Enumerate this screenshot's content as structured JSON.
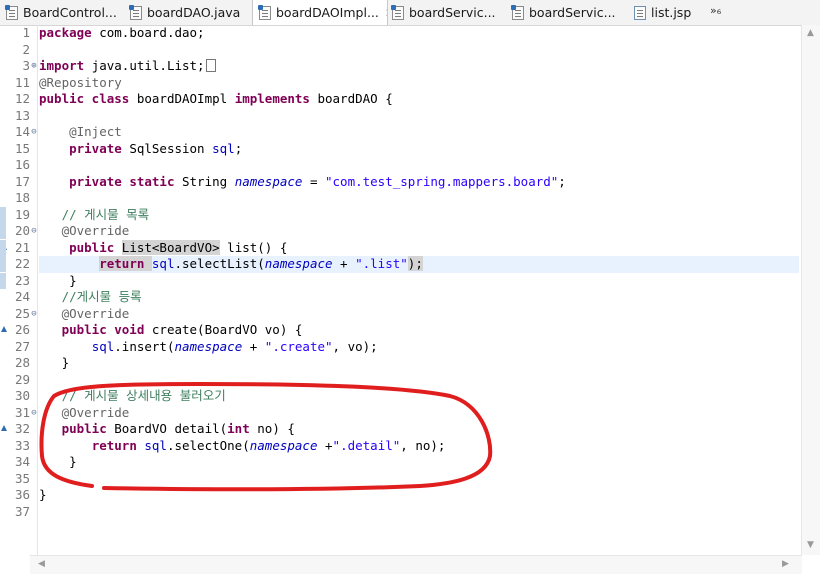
{
  "tabs": [
    {
      "label": "BoardControl...",
      "icon": "java-file-icon",
      "active": false,
      "closable": false
    },
    {
      "label": "boardDAO.java",
      "icon": "java-file-icon",
      "active": false,
      "closable": false
    },
    {
      "label": "boardDAOImpl...",
      "icon": "java-file-icon",
      "active": true,
      "closable": true
    },
    {
      "label": "boardServic...",
      "icon": "java-file-icon",
      "active": false,
      "closable": false
    },
    {
      "label": "boardServic...",
      "icon": "java-file-icon",
      "active": false,
      "closable": false
    },
    {
      "label": "list.jsp",
      "icon": "jsp-file-icon",
      "active": false,
      "closable": false
    }
  ],
  "tab_overflow": "»₆",
  "colors": {
    "annotation_circle": "#e01e1e",
    "keyword": "#7f0055",
    "string": "#2a00ff",
    "comment": "#3f7f5f",
    "field": "#0000c0"
  },
  "editor": {
    "line_numbers": [
      "1",
      "2",
      "3",
      "11",
      "12",
      "13",
      "14",
      "15",
      "16",
      "17",
      "18",
      "19",
      "20",
      "21",
      "22",
      "23",
      "24",
      "25",
      "26",
      "27",
      "28",
      "29",
      "30",
      "31",
      "32",
      "33",
      "34",
      "35",
      "36",
      "37"
    ],
    "folds": [
      "",
      "",
      "⊕",
      "",
      "",
      "",
      "⊖",
      "",
      "",
      "",
      "",
      "",
      "⊖",
      "",
      "",
      "",
      "",
      "⊖",
      "",
      "",
      "",
      "",
      "",
      "⊖",
      "",
      "",
      "",
      "",
      "",
      ""
    ],
    "override_markers": [
      "21",
      "26",
      "32"
    ],
    "highlight_line": "22",
    "lines": [
      [
        {
          "t": "package ",
          "c": "kw"
        },
        {
          "t": "com.board.dao;",
          "c": "tx"
        }
      ],
      [],
      [
        {
          "t": "import ",
          "c": "kw"
        },
        {
          "t": "java.util.List;",
          "c": "tx"
        }
      ],
      [
        {
          "t": "@Repository",
          "c": "an"
        }
      ],
      [
        {
          "t": "public class ",
          "c": "kw"
        },
        {
          "t": "boardDAOImpl ",
          "c": "tx"
        },
        {
          "t": "implements ",
          "c": "kw"
        },
        {
          "t": "boardDAO {",
          "c": "tx"
        }
      ],
      [],
      [
        {
          "t": "    @Inject",
          "c": "an"
        }
      ],
      [
        {
          "t": "    ",
          "c": "tx"
        },
        {
          "t": "private ",
          "c": "kw"
        },
        {
          "t": "SqlSession ",
          "c": "tx"
        },
        {
          "t": "sql",
          "c": "fi"
        },
        {
          "t": ";",
          "c": "tx"
        }
      ],
      [],
      [
        {
          "t": "    ",
          "c": "tx"
        },
        {
          "t": "private static ",
          "c": "kw"
        },
        {
          "t": "String ",
          "c": "tx"
        },
        {
          "t": "namespace",
          "c": "sfi"
        },
        {
          "t": " = ",
          "c": "tx"
        },
        {
          "t": "\"com.test_spring.mappers.board\"",
          "c": "st"
        },
        {
          "t": ";",
          "c": "tx"
        }
      ],
      [],
      [
        {
          "t": "   // 게시물 목록",
          "c": "cm"
        }
      ],
      [
        {
          "t": "   @Override",
          "c": "an"
        }
      ],
      [
        {
          "t": "    ",
          "c": "tx"
        },
        {
          "t": "public ",
          "c": "kw"
        },
        {
          "t": "List<BoardVO>",
          "c": "tx",
          "sel": true
        },
        {
          "t": " list() {",
          "c": "tx"
        }
      ],
      [
        {
          "t": "        ",
          "c": "tx"
        },
        {
          "t": "return ",
          "c": "kw",
          "sel": true
        },
        {
          "t": "sql",
          "c": "fi"
        },
        {
          "t": ".selectList(",
          "c": "tx"
        },
        {
          "t": "namespace",
          "c": "sfi"
        },
        {
          "t": " + ",
          "c": "tx"
        },
        {
          "t": "\".list\"",
          "c": "st"
        },
        {
          "t": ");",
          "c": "tx",
          "sel": true
        }
      ],
      [
        {
          "t": "    }",
          "c": "tx"
        }
      ],
      [
        {
          "t": "   //게시물 등록",
          "c": "cm"
        }
      ],
      [
        {
          "t": "   @Override",
          "c": "an"
        }
      ],
      [
        {
          "t": "   ",
          "c": "tx"
        },
        {
          "t": "public void ",
          "c": "kw"
        },
        {
          "t": "create(BoardVO vo) {",
          "c": "tx"
        }
      ],
      [
        {
          "t": "       ",
          "c": "tx"
        },
        {
          "t": "sql",
          "c": "fi"
        },
        {
          "t": ".insert(",
          "c": "tx"
        },
        {
          "t": "namespace",
          "c": "sfi"
        },
        {
          "t": " + ",
          "c": "tx"
        },
        {
          "t": "\".create\"",
          "c": "st"
        },
        {
          "t": ", vo);",
          "c": "tx"
        }
      ],
      [
        {
          "t": "   }",
          "c": "tx"
        }
      ],
      [],
      [
        {
          "t": "   // 게시물 상세내용 불러오기",
          "c": "cm"
        }
      ],
      [
        {
          "t": "   @Override",
          "c": "an"
        }
      ],
      [
        {
          "t": "   ",
          "c": "tx"
        },
        {
          "t": "public ",
          "c": "kw"
        },
        {
          "t": "BoardVO detail(",
          "c": "tx"
        },
        {
          "t": "int ",
          "c": "kw"
        },
        {
          "t": "no) {",
          "c": "tx"
        }
      ],
      [
        {
          "t": "       ",
          "c": "tx"
        },
        {
          "t": "return ",
          "c": "kw"
        },
        {
          "t": "sql",
          "c": "fi"
        },
        {
          "t": ".selectOne(",
          "c": "tx"
        },
        {
          "t": "namespace",
          "c": "sfi"
        },
        {
          "t": " +",
          "c": "tx"
        },
        {
          "t": "\".detail\"",
          "c": "st"
        },
        {
          "t": ", no);",
          "c": "tx"
        }
      ],
      [
        {
          "t": "    }",
          "c": "tx"
        }
      ],
      [],
      [
        {
          "t": "}",
          "c": "tx"
        }
      ],
      []
    ]
  }
}
